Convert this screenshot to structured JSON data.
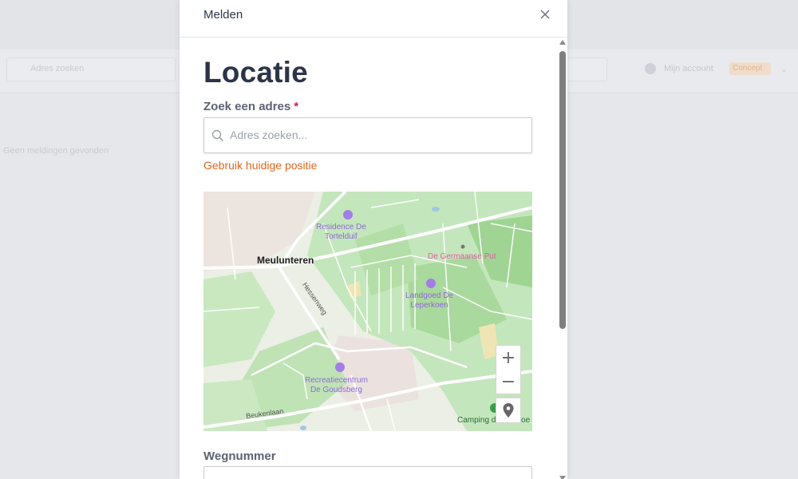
{
  "background": {
    "search_placeholder": "Adres zoeken",
    "user_name": "Mijn account",
    "status_badge": "Concept",
    "body_text": "Geen meldingen gevonden"
  },
  "modal": {
    "title": "Melden",
    "close_icon": "close-icon",
    "heading": "Locatie",
    "address_label": "Zoek een adres",
    "required_marker": "*",
    "search_placeholder": "Adres zoeken...",
    "search_value": "",
    "use_current_position": "Gebruik huidige positie",
    "road_number_label": "Wegnummer"
  },
  "map": {
    "labels": {
      "residence": "Residence De Tortelduif",
      "germaanse": "De Germaanse Put",
      "town": "Meulunteren",
      "hessenweg": "Hessenweg",
      "landgoed": "Landgoed De Leperkoen",
      "recreatie": "Recreatiecentrum De Goudsberg",
      "beukenlaan": "Beukenlaan",
      "camping": "Camping de Rimboe"
    },
    "controls": {
      "zoom_in": "+",
      "zoom_out": "−"
    }
  },
  "colors": {
    "accent": "#e4661b",
    "required": "#c4245a",
    "heading": "#2b3547",
    "map_green": "#bfe3b5",
    "map_poi": "#8e6ad8"
  }
}
